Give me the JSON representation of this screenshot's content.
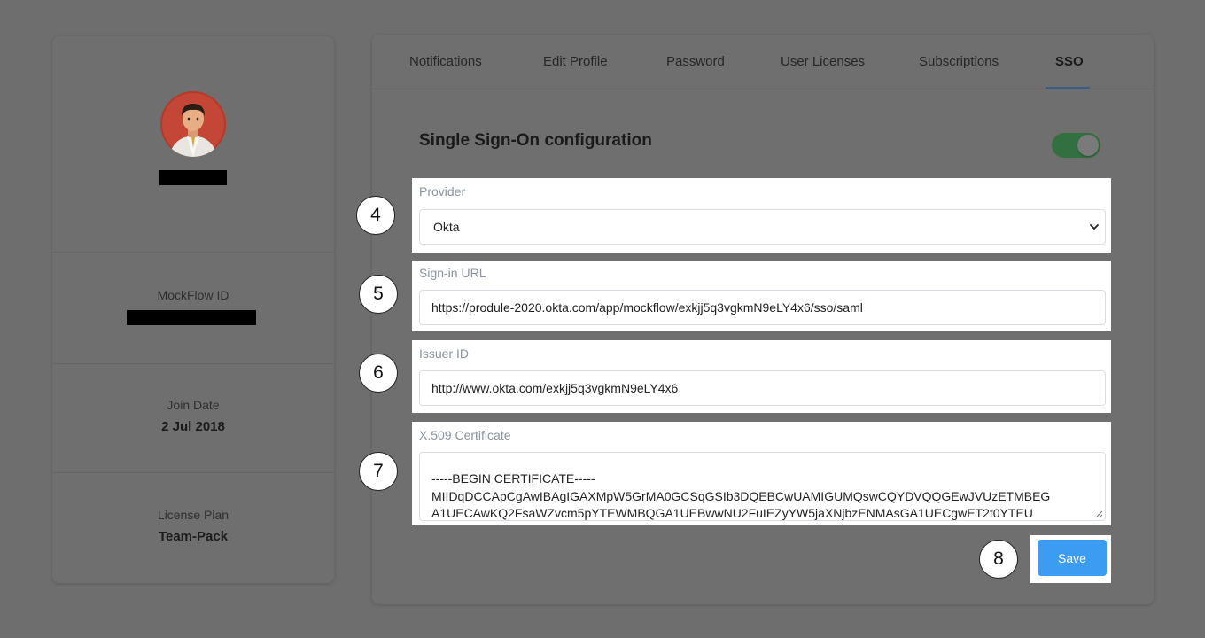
{
  "profile": {
    "mockflow_id_label": "MockFlow ID",
    "join_date_label": "Join Date",
    "join_date_value": "2 Jul 2018",
    "license_plan_label": "License Plan",
    "license_plan_value": "Team-Pack"
  },
  "tabs": [
    {
      "label": "Notifications",
      "active": false
    },
    {
      "label": "Edit Profile",
      "active": false
    },
    {
      "label": "Password",
      "active": false
    },
    {
      "label": "User Licenses",
      "active": false
    },
    {
      "label": "Subscriptions",
      "active": false
    },
    {
      "label": "SSO",
      "active": true
    }
  ],
  "sso": {
    "title": "Single Sign-On configuration",
    "enabled": true,
    "provider": {
      "label": "Provider",
      "value": "Okta",
      "step": "4"
    },
    "signin_url": {
      "label": "Sign-in URL",
      "value": "https://produle-2020.okta.com/app/mockflow/exkjj5q3vgkmN9eLY4x6/sso/saml",
      "step": "5"
    },
    "issuer_id": {
      "label": "Issuer ID",
      "value": "http://www.okta.com/exkjj5q3vgkmN9eLY4x6",
      "step": "6"
    },
    "certificate": {
      "label": "X.509 Certificate",
      "value": "-----BEGIN CERTIFICATE-----\nMIIDqDCCApCgAwIBAgIGAXMpW5GrMA0GCSqGSIb3DQEBCwUAMIGUMQswCQYDVQQGEwJVUzETMBEG\nA1UECAwKQ2FsaWZvcm5pYTEWMBQGA1UEBwwNU2FuIEZyYW5jaXNjbzENMAsGA1UECgwET2t0YTEU",
      "step": "7"
    },
    "save": {
      "label": "Save",
      "step": "8"
    }
  },
  "colors": {
    "overlay_background": "#6e6e6e",
    "save_button": "#3b9cf2",
    "toggle_on": "#33703f",
    "tab_underline": "#355f87"
  }
}
